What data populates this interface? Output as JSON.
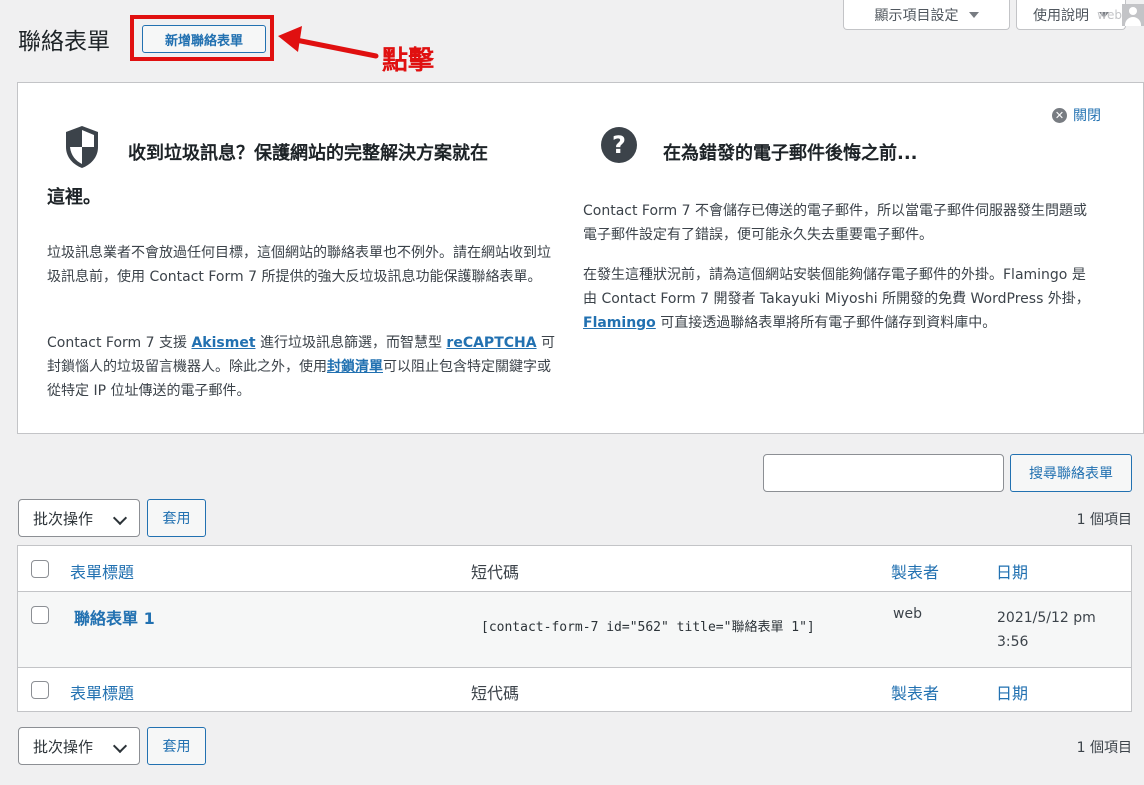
{
  "screen_meta": {
    "options_label": "顯示項目設定",
    "help_label": "使用說明",
    "ghost_user": "web"
  },
  "header": {
    "title": "聯絡表單",
    "add_new_label": "新增聯絡表單",
    "annotation": "點擊"
  },
  "welcome": {
    "dismiss_label": "關閉",
    "left": {
      "heading_line1": "收到垃圾訊息？保護網站的完整解決方案就在",
      "heading_line2": "這裡。",
      "p1": "垃圾訊息業者不會放過任何目標，這個網站的聯絡表單也不例外。請在網站收到垃圾訊息前，使用 Contact Form 7 所提供的強大反垃圾訊息功能保護聯絡表單。",
      "p2_a": "Contact Form 7 支援 ",
      "p2_link1": "Akismet",
      "p2_b": " 進行垃圾訊息篩選，而智慧型 ",
      "p2_link2": "reCAPTCHA",
      "p2_c": " 可封鎖惱人的垃圾留言機器人。除此之外，使用",
      "p2_link3": "封鎖清單",
      "p2_d": "可以阻止包含特定關鍵字或從特定 IP 位址傳送的電子郵件。"
    },
    "right": {
      "heading": "在為錯發的電子郵件後悔之前...",
      "p1": "Contact Form 7 不會儲存已傳送的電子郵件，所以當電子郵件伺服器發生問題或電子郵件設定有了錯誤，便可能永久失去重要電子郵件。",
      "p2_a": "在發生這種狀況前，請為這個網站安裝個能夠儲存電子郵件的外掛。Flamingo 是由 Contact Form 7 開發者 Takayuki Miyoshi 所開發的免費 WordPress 外掛，",
      "p2_link": "Flamingo",
      "p2_b": " 可直接透過聯絡表單將所有電子郵件儲存到資料庫中。"
    }
  },
  "search": {
    "value": "",
    "button_label": "搜尋聯絡表單"
  },
  "bulk_top": {
    "selected": "批次操作",
    "apply_label": "套用",
    "count": "1 個項目"
  },
  "bulk_bottom": {
    "selected": "批次操作",
    "apply_label": "套用",
    "count": "1 個項目"
  },
  "table": {
    "columns": {
      "title": "表單標題",
      "shortcode": "短代碼",
      "author": "製表者",
      "date": "日期"
    },
    "rows": [
      {
        "title": "聯絡表單 1",
        "shortcode": "[contact-form-7 id=\"562\" title=\"聯絡表單 1\"]",
        "author": "web",
        "date_line1": "2021/5/12 pm",
        "date_line2": "3:56"
      }
    ]
  }
}
